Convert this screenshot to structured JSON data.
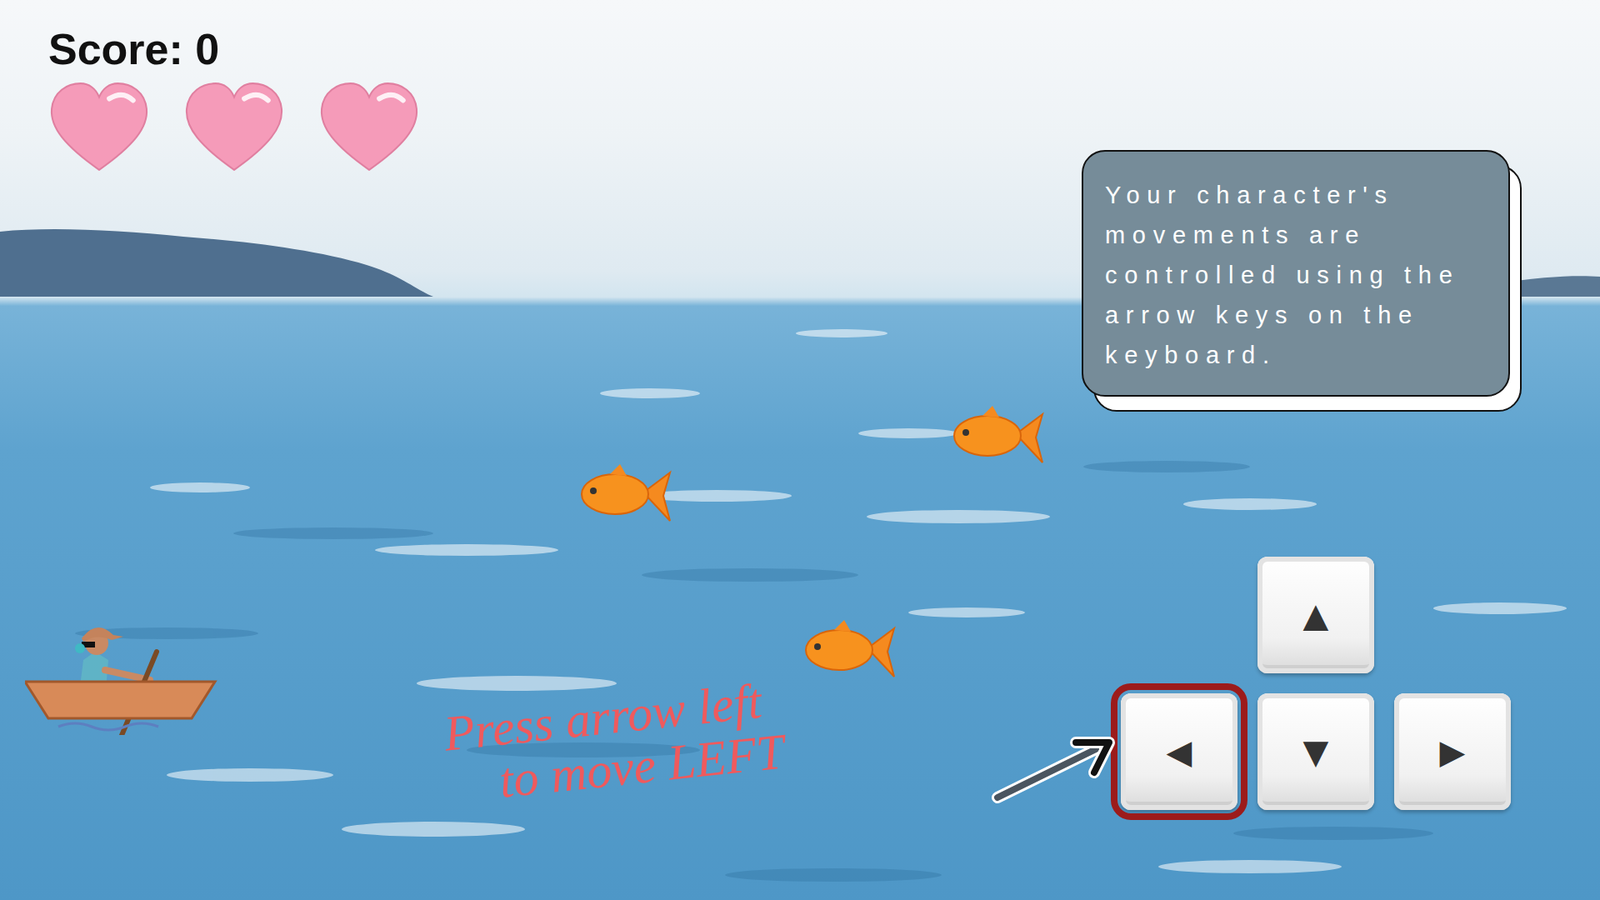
{
  "hud": {
    "score": "Score: 0",
    "lives": [
      {
        "filled": true
      },
      {
        "filled": true
      },
      {
        "filled": true
      }
    ]
  },
  "tooltip": {
    "text": "Your character's movements are controlled using the arrow keys on the keyboard."
  },
  "keys": [
    {
      "label": "▲",
      "selected": false
    },
    {
      "label": "◀",
      "selected": true
    },
    {
      "label": "▼",
      "selected": false
    },
    {
      "label": "▶",
      "selected": false
    }
  ],
  "hint": {
    "lines": [
      "Press arrow left",
      "to move LEFT"
    ]
  }
}
